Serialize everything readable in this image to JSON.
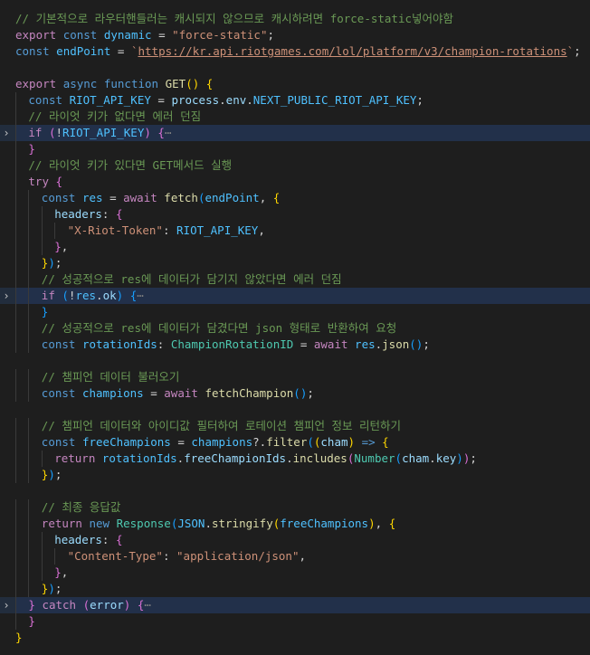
{
  "editor": {
    "lines": [
      {
        "tokens": [
          [
            "comment",
            "// 기본적으로 라우터핸들러는 캐시되지 않으므로 캐시하려면 force-static넣어야함"
          ]
        ]
      },
      {
        "tokens": [
          [
            "ctrl",
            "export"
          ],
          [
            "punc",
            " "
          ],
          [
            "kw",
            "const"
          ],
          [
            "punc",
            " "
          ],
          [
            "const",
            "dynamic"
          ],
          [
            "punc",
            " = "
          ],
          [
            "str",
            "\"force-static\""
          ],
          [
            "punc",
            ";"
          ]
        ]
      },
      {
        "tokens": [
          [
            "kw",
            "const"
          ],
          [
            "punc",
            " "
          ],
          [
            "const",
            "endPoint"
          ],
          [
            "punc",
            " = "
          ],
          [
            "str",
            "`"
          ],
          [
            "url",
            "https://kr.api.riotgames.com/lol/platform/v3/champion-rotations"
          ],
          [
            "str",
            "`"
          ],
          [
            "punc",
            ";"
          ]
        ]
      },
      {
        "tokens": []
      },
      {
        "tokens": [
          [
            "ctrl",
            "export"
          ],
          [
            "punc",
            " "
          ],
          [
            "kw",
            "async"
          ],
          [
            "punc",
            " "
          ],
          [
            "kw",
            "function"
          ],
          [
            "punc",
            " "
          ],
          [
            "func",
            "GET"
          ],
          [
            "b1",
            "()"
          ],
          [
            "punc",
            " "
          ],
          [
            "b1",
            "{"
          ]
        ]
      },
      {
        "indent": 1,
        "tokens": [
          [
            "kw",
            "const"
          ],
          [
            "punc",
            " "
          ],
          [
            "const",
            "RIOT_API_KEY"
          ],
          [
            "punc",
            " = "
          ],
          [
            "var",
            "process"
          ],
          [
            "punc",
            "."
          ],
          [
            "var",
            "env"
          ],
          [
            "punc",
            "."
          ],
          [
            "const",
            "NEXT_PUBLIC_RIOT_API_KEY"
          ],
          [
            "punc",
            ";"
          ]
        ]
      },
      {
        "indent": 1,
        "tokens": [
          [
            "comment",
            "// 라이엇 키가 없다면 에러 던짐"
          ]
        ]
      },
      {
        "indent": 1,
        "fold": true,
        "hl": true,
        "tokens": [
          [
            "ctrl",
            "if"
          ],
          [
            "punc",
            " "
          ],
          [
            "b2",
            "("
          ],
          [
            "punc",
            "!"
          ],
          [
            "const",
            "RIOT_API_KEY"
          ],
          [
            "b2",
            ")"
          ],
          [
            "punc",
            " "
          ],
          [
            "b2",
            "{"
          ],
          [
            "fold",
            "⋯"
          ]
        ]
      },
      {
        "indent": 1,
        "tokens": [
          [
            "b2",
            "}"
          ]
        ]
      },
      {
        "indent": 1,
        "tokens": [
          [
            "comment",
            "// 라이엇 키가 있다면 GET메서드 실행"
          ]
        ]
      },
      {
        "indent": 1,
        "tokens": [
          [
            "ctrl",
            "try"
          ],
          [
            "punc",
            " "
          ],
          [
            "b2",
            "{"
          ]
        ]
      },
      {
        "indent": 2,
        "tokens": [
          [
            "kw",
            "const"
          ],
          [
            "punc",
            " "
          ],
          [
            "const",
            "res"
          ],
          [
            "punc",
            " = "
          ],
          [
            "ctrl",
            "await"
          ],
          [
            "punc",
            " "
          ],
          [
            "func",
            "fetch"
          ],
          [
            "b3",
            "("
          ],
          [
            "const",
            "endPoint"
          ],
          [
            "punc",
            ", "
          ],
          [
            "b1",
            "{"
          ]
        ]
      },
      {
        "indent": 3,
        "tokens": [
          [
            "var",
            "headers"
          ],
          [
            "punc",
            ": "
          ],
          [
            "b2",
            "{"
          ]
        ]
      },
      {
        "indent": 4,
        "tokens": [
          [
            "str",
            "\"X-Riot-Token\""
          ],
          [
            "punc",
            ": "
          ],
          [
            "const",
            "RIOT_API_KEY"
          ],
          [
            "punc",
            ","
          ]
        ]
      },
      {
        "indent": 3,
        "tokens": [
          [
            "b2",
            "}"
          ],
          [
            "punc",
            ","
          ]
        ]
      },
      {
        "indent": 2,
        "tokens": [
          [
            "b1",
            "}"
          ],
          [
            "b3",
            ")"
          ],
          [
            "punc",
            ";"
          ]
        ]
      },
      {
        "indent": 2,
        "tokens": [
          [
            "comment",
            "// 성공적으로 res에 데이터가 담기지 않았다면 에러 던짐"
          ]
        ]
      },
      {
        "indent": 2,
        "fold": true,
        "hl": true,
        "tokens": [
          [
            "ctrl",
            "if"
          ],
          [
            "punc",
            " "
          ],
          [
            "b3",
            "("
          ],
          [
            "punc",
            "!"
          ],
          [
            "const",
            "res"
          ],
          [
            "punc",
            "."
          ],
          [
            "var",
            "ok"
          ],
          [
            "b3",
            ")"
          ],
          [
            "punc",
            " "
          ],
          [
            "b3",
            "{"
          ],
          [
            "fold",
            "⋯"
          ]
        ]
      },
      {
        "indent": 2,
        "tokens": [
          [
            "b3",
            "}"
          ]
        ]
      },
      {
        "indent": 2,
        "tokens": [
          [
            "comment",
            "// 성공적으로 res에 데이터가 담겼다면 json 형태로 반환하여 요청"
          ]
        ]
      },
      {
        "indent": 2,
        "tokens": [
          [
            "kw",
            "const"
          ],
          [
            "punc",
            " "
          ],
          [
            "const",
            "rotationIds"
          ],
          [
            "punc",
            ": "
          ],
          [
            "type",
            "ChampionRotationID"
          ],
          [
            "punc",
            " = "
          ],
          [
            "ctrl",
            "await"
          ],
          [
            "punc",
            " "
          ],
          [
            "const",
            "res"
          ],
          [
            "punc",
            "."
          ],
          [
            "func",
            "json"
          ],
          [
            "b3",
            "()"
          ],
          [
            "punc",
            ";"
          ]
        ]
      },
      {
        "tokens": []
      },
      {
        "indent": 2,
        "tokens": [
          [
            "comment",
            "// 챔피언 데이터 불러오기"
          ]
        ]
      },
      {
        "indent": 2,
        "tokens": [
          [
            "kw",
            "const"
          ],
          [
            "punc",
            " "
          ],
          [
            "const",
            "champions"
          ],
          [
            "punc",
            " = "
          ],
          [
            "ctrl",
            "await"
          ],
          [
            "punc",
            " "
          ],
          [
            "func",
            "fetchChampion"
          ],
          [
            "b3",
            "()"
          ],
          [
            "punc",
            ";"
          ]
        ]
      },
      {
        "tokens": []
      },
      {
        "indent": 2,
        "tokens": [
          [
            "comment",
            "// 챔피언 데이터와 아이디값 필터하여 로테이션 챔피언 정보 리턴하기"
          ]
        ]
      },
      {
        "indent": 2,
        "tokens": [
          [
            "kw",
            "const"
          ],
          [
            "punc",
            " "
          ],
          [
            "const",
            "freeChampions"
          ],
          [
            "punc",
            " = "
          ],
          [
            "const",
            "champions"
          ],
          [
            "punc",
            "?."
          ],
          [
            "func",
            "filter"
          ],
          [
            "b3",
            "("
          ],
          [
            "b1",
            "("
          ],
          [
            "var",
            "cham"
          ],
          [
            "b1",
            ")"
          ],
          [
            "punc",
            " "
          ],
          [
            "kw",
            "=>"
          ],
          [
            "punc",
            " "
          ],
          [
            "b1",
            "{"
          ]
        ]
      },
      {
        "indent": 3,
        "tokens": [
          [
            "ctrl",
            "return"
          ],
          [
            "punc",
            " "
          ],
          [
            "const",
            "rotationIds"
          ],
          [
            "punc",
            "."
          ],
          [
            "var",
            "freeChampionIds"
          ],
          [
            "punc",
            "."
          ],
          [
            "func",
            "includes"
          ],
          [
            "b2",
            "("
          ],
          [
            "type",
            "Number"
          ],
          [
            "b3",
            "("
          ],
          [
            "var",
            "cham"
          ],
          [
            "punc",
            "."
          ],
          [
            "var",
            "key"
          ],
          [
            "b3",
            ")"
          ],
          [
            "b2",
            ")"
          ],
          [
            "punc",
            ";"
          ]
        ]
      },
      {
        "indent": 2,
        "tokens": [
          [
            "b1",
            "}"
          ],
          [
            "b3",
            ")"
          ],
          [
            "punc",
            ";"
          ]
        ]
      },
      {
        "tokens": []
      },
      {
        "indent": 2,
        "tokens": [
          [
            "comment",
            "// 최종 응답값"
          ]
        ]
      },
      {
        "indent": 2,
        "tokens": [
          [
            "ctrl",
            "return"
          ],
          [
            "punc",
            " "
          ],
          [
            "kw",
            "new"
          ],
          [
            "punc",
            " "
          ],
          [
            "type",
            "Response"
          ],
          [
            "b3",
            "("
          ],
          [
            "const",
            "JSON"
          ],
          [
            "punc",
            "."
          ],
          [
            "func",
            "stringify"
          ],
          [
            "b1",
            "("
          ],
          [
            "const",
            "freeChampions"
          ],
          [
            "b1",
            ")"
          ],
          [
            "punc",
            ", "
          ],
          [
            "b1",
            "{"
          ]
        ]
      },
      {
        "indent": 3,
        "tokens": [
          [
            "var",
            "headers"
          ],
          [
            "punc",
            ": "
          ],
          [
            "b2",
            "{"
          ]
        ]
      },
      {
        "indent": 4,
        "tokens": [
          [
            "str",
            "\"Content-Type\""
          ],
          [
            "punc",
            ": "
          ],
          [
            "str",
            "\"application/json\""
          ],
          [
            "punc",
            ","
          ]
        ]
      },
      {
        "indent": 3,
        "tokens": [
          [
            "b2",
            "}"
          ],
          [
            "punc",
            ","
          ]
        ]
      },
      {
        "indent": 2,
        "tokens": [
          [
            "b1",
            "}"
          ],
          [
            "b3",
            ")"
          ],
          [
            "punc",
            ";"
          ]
        ]
      },
      {
        "indent": 1,
        "fold": true,
        "hl": true,
        "tokens": [
          [
            "b2",
            "}"
          ],
          [
            "punc",
            " "
          ],
          [
            "ctrl",
            "catch"
          ],
          [
            "punc",
            " "
          ],
          [
            "b2",
            "("
          ],
          [
            "var",
            "error"
          ],
          [
            "b2",
            ")"
          ],
          [
            "punc",
            " "
          ],
          [
            "b2",
            "{"
          ],
          [
            "fold",
            "⋯"
          ]
        ]
      },
      {
        "indent": 1,
        "tokens": [
          [
            "b2",
            "}"
          ]
        ]
      },
      {
        "tokens": [
          [
            "b1",
            "}"
          ]
        ]
      }
    ]
  },
  "icons": {
    "fold": "chevron-right-icon"
  },
  "colors": {
    "background": "#1e1e1e",
    "comment": "#6a9955",
    "keyword": "#569cd6",
    "control": "#c586c0",
    "constant": "#4fc1ff",
    "function": "#dcdcaa",
    "string": "#ce9178",
    "type": "#4ec9b0",
    "bracket1": "#ffd700",
    "bracket2": "#da70d6",
    "bracket3": "#179fff"
  }
}
